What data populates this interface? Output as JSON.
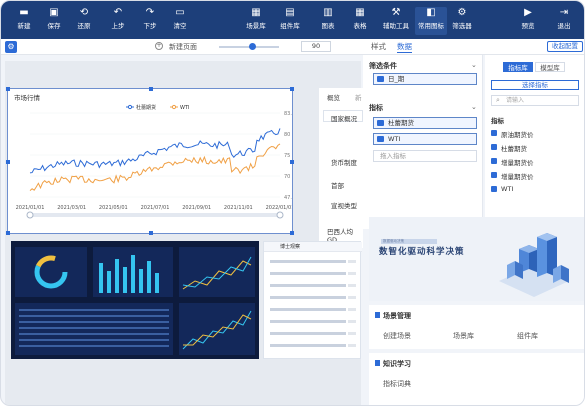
{
  "toolbar": {
    "new": "新建",
    "save": "保存",
    "restore": "还原",
    "up": "上步",
    "down": "下步",
    "clear": "清空",
    "scene_lib": "场景库",
    "component_lib": "组件库",
    "charts": "图表",
    "tables": "表格",
    "aux_tools": "辅助工具",
    "common_icons": "常用图标",
    "filter": "筛选器",
    "preview": "预览",
    "exit": "退出"
  },
  "bar2": {
    "page_name": "新建页面",
    "zoom": "90",
    "tab_style": "样式",
    "tab_data": "数据",
    "collapse": "收起配置"
  },
  "chart_card": {
    "title": "市场行情"
  },
  "chart_data": {
    "type": "line",
    "series": [
      {
        "name": "杜蕾期货"
      },
      {
        "name": "WTI"
      }
    ],
    "x_ticks": [
      "2021/01/01",
      "2021/03/01",
      "2021/05/01",
      "2021/07/01",
      "2021/09/01",
      "2021/11/01",
      "2022/01/01"
    ],
    "y_ticks_right": [
      "83.92",
      "80",
      "75",
      "70",
      "47.38"
    ],
    "ylim": [
      47.38,
      83.92
    ]
  },
  "side_tabs": {
    "tab1": "概览",
    "tab2": "新"
  },
  "side_list": [
    "国家概况",
    "货币制度",
    "首部",
    "宣视类型",
    "巴西人均GD"
  ],
  "panel": {
    "filter_title": "筛选条件",
    "date_field": "日_期",
    "metric_title": "指标",
    "metric_fields": [
      "杜蕾期货",
      "WTI"
    ],
    "add_metric": "拖入指标"
  },
  "far": {
    "tab_metric_lib": "指标库",
    "tab_model_lib": "模型库",
    "select_btn": "选择指标",
    "search_placeholder": "请输入",
    "section": "指标",
    "items": [
      "原油期货价",
      "杜蕾期货",
      "增量期货价",
      "增量期货价",
      "WTI"
    ]
  },
  "banner": {
    "small": "数据驱动决策",
    "big": "数智化驱动科学决策"
  },
  "scene_card": {
    "title": "场景管理",
    "links": [
      "创建场景",
      "场景库",
      "组件库"
    ]
  },
  "learn_card": {
    "title": "知识学习",
    "links": [
      "指标词典"
    ]
  },
  "news_panel": {
    "title": "博士观察"
  },
  "colors": {
    "brand": "#1d3f7a",
    "accent": "#2d6bd6",
    "series1": "#2d6bd6",
    "series2": "#f0a045"
  }
}
